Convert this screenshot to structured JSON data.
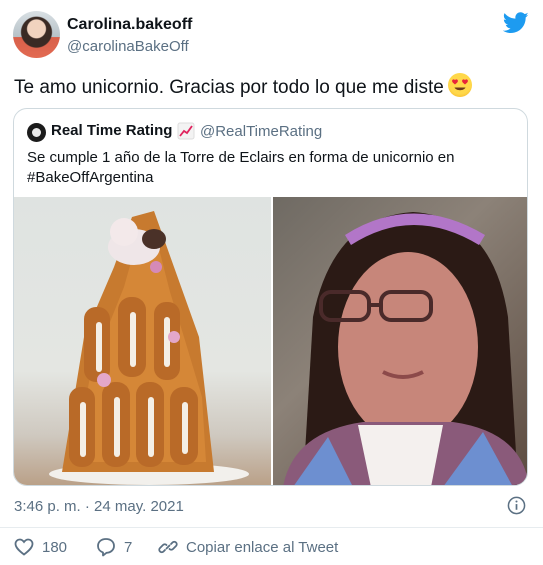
{
  "author": {
    "display_name": "Carolina.bakeoff",
    "handle": "@carolinaBakeOff"
  },
  "tweet": {
    "text": "Te amo unicornio. Gracias por todo lo que me diste",
    "emoji": "heart-eyes-emoji"
  },
  "quoted": {
    "display_name": "Real Time Rating",
    "handle": "@RealTimeRating",
    "text": "Se cumple 1 año de la Torre de Eclairs en forma de unicornio en #BakeOffArgentina"
  },
  "meta": {
    "timestamp": "3:46 p. m. · 24 may. 2021"
  },
  "actions": {
    "likes": "180",
    "replies": "7",
    "copy_link": "Copiar enlace al Tweet"
  },
  "colors": {
    "twitter_blue": "#1d9bf0",
    "like_red": "#e0245e",
    "secondary_text": "#5b7083"
  }
}
